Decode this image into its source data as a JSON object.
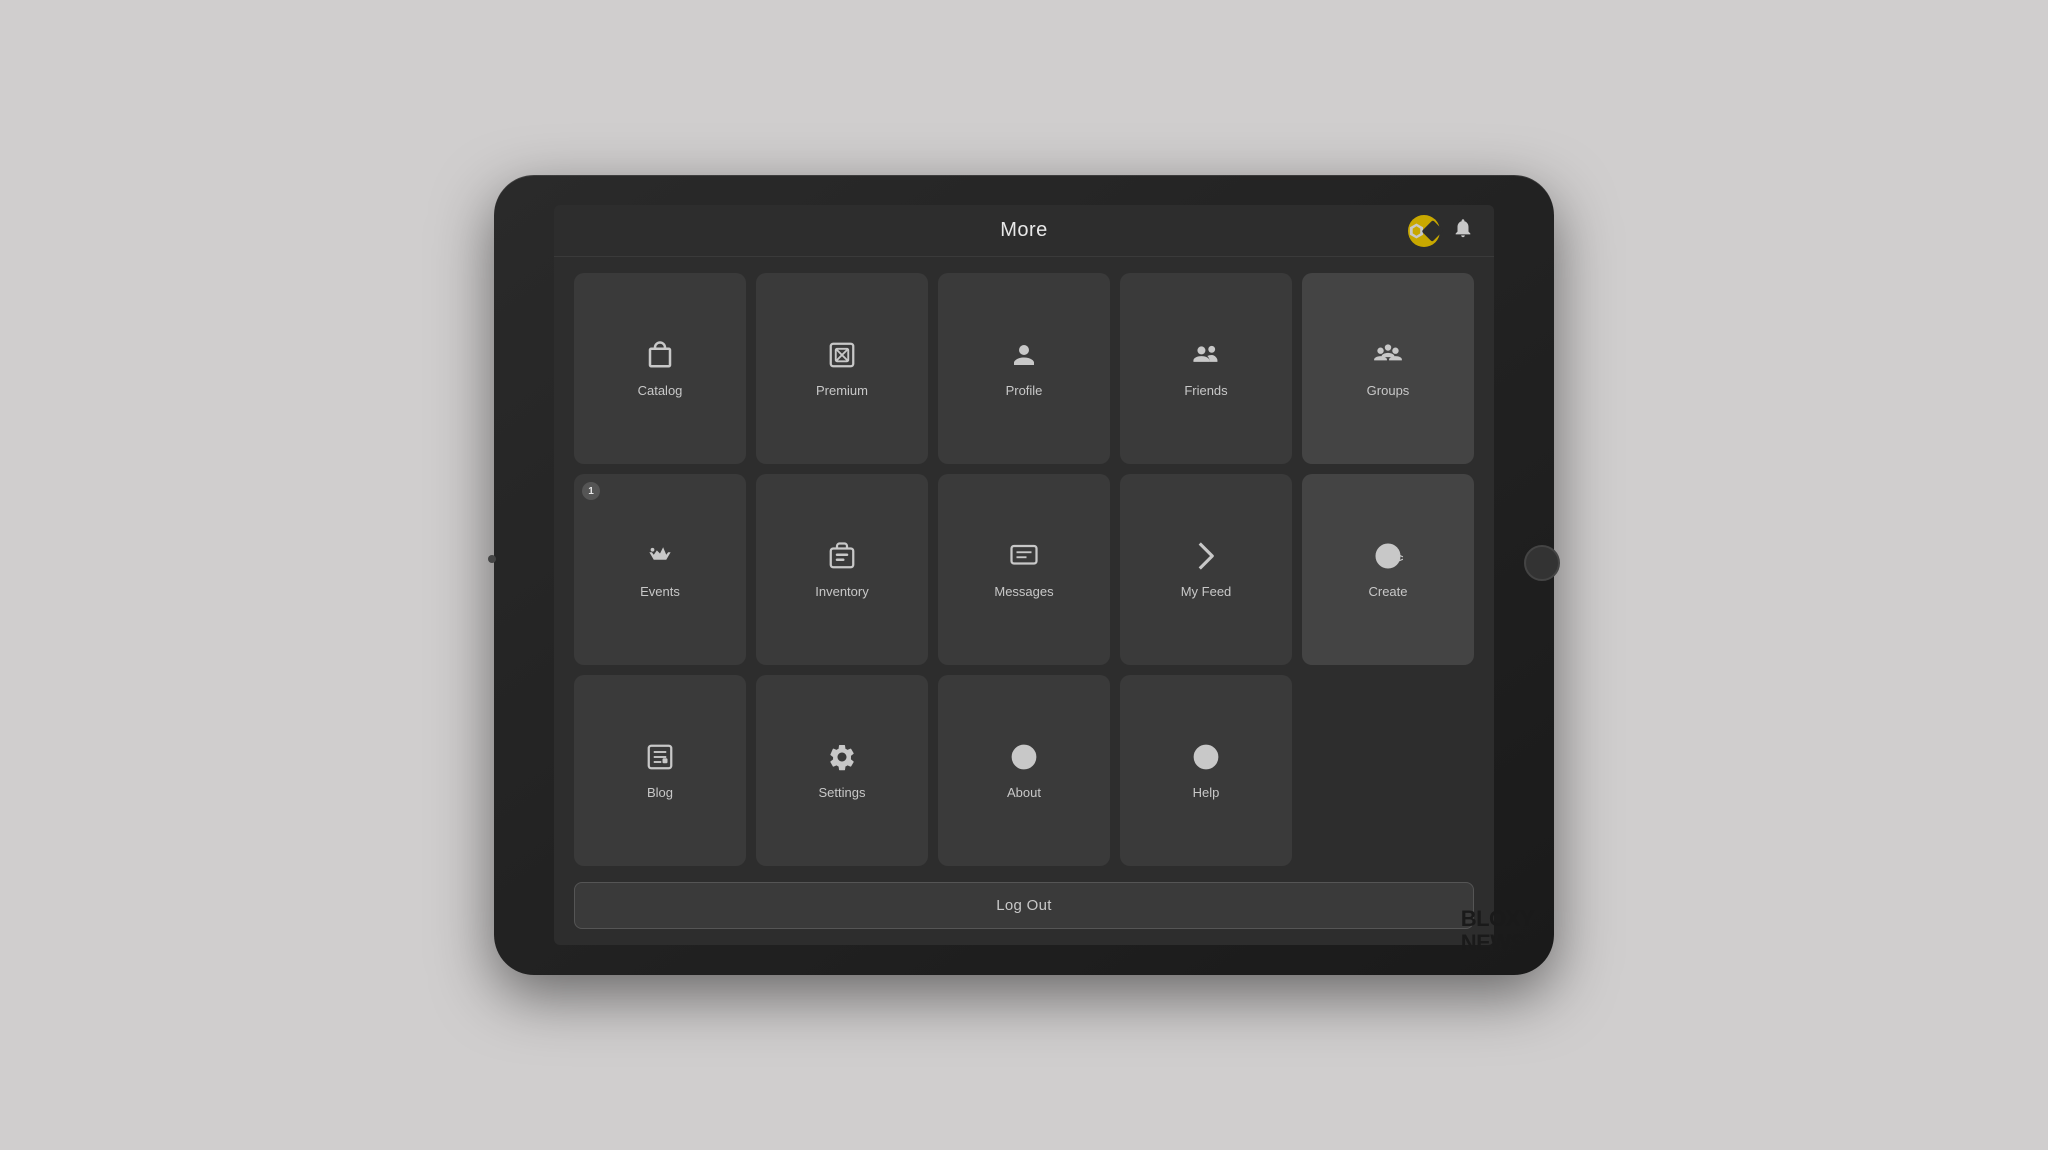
{
  "header": {
    "title": "More"
  },
  "icons": {
    "robux": "◈",
    "bell": "🔔"
  },
  "grid": {
    "row1": [
      {
        "id": "catalog",
        "label": "Catalog",
        "icon": "catalog"
      },
      {
        "id": "premium",
        "label": "Premium",
        "icon": "premium"
      },
      {
        "id": "profile",
        "label": "Profile",
        "icon": "profile"
      },
      {
        "id": "friends",
        "label": "Friends",
        "icon": "friends"
      },
      {
        "id": "groups",
        "label": "Groups",
        "icon": "groups"
      }
    ],
    "row2": [
      {
        "id": "events",
        "label": "Events",
        "icon": "events",
        "badge": "1"
      },
      {
        "id": "inventory",
        "label": "Inventory",
        "icon": "inventory"
      },
      {
        "id": "messages",
        "label": "Messages",
        "icon": "messages"
      },
      {
        "id": "myfeed",
        "label": "My Feed",
        "icon": "myfeed"
      },
      {
        "id": "create",
        "label": "Create",
        "icon": "create"
      }
    ],
    "row3": [
      {
        "id": "blog",
        "label": "Blog",
        "icon": "blog"
      },
      {
        "id": "settings",
        "label": "Settings",
        "icon": "settings"
      },
      {
        "id": "about",
        "label": "About",
        "icon": "about"
      },
      {
        "id": "help",
        "label": "Help",
        "icon": "help"
      }
    ]
  },
  "logout": {
    "label": "Log Out"
  },
  "watermark": {
    "line1": "BLOXY",
    "line2": "NEWS."
  }
}
